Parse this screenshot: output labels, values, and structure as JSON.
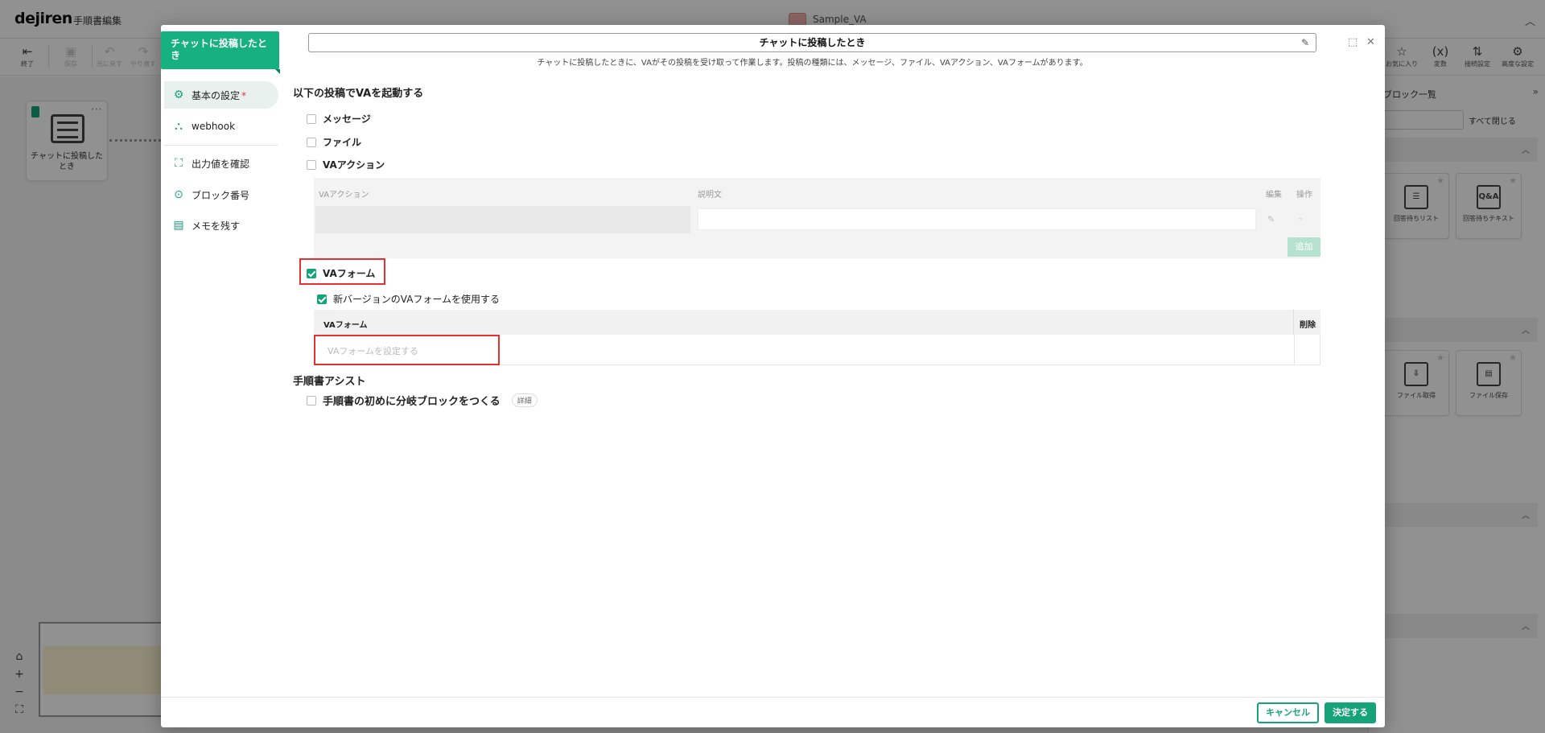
{
  "app": {
    "logo": "dejiren",
    "title": "手順書編集",
    "doc_name": "Sample_VA"
  },
  "toolbar": {
    "exit": "終了",
    "save": "保存",
    "undo": "元に戻す",
    "redo": "やり直す",
    "favorites": "お気に入り",
    "variables": "変数",
    "connection_settings": "接続設定",
    "advanced_settings": "高度な設定"
  },
  "canvas": {
    "node_label": "チャットに投稿したとき"
  },
  "right_panel": {
    "title": "ブロック一覧",
    "close_all": "すべて閉じる",
    "cards": [
      {
        "label": "回答待ちリスト",
        "icon": "list-icon"
      },
      {
        "label": "回答待ちテキスト",
        "icon": "qa-icon",
        "glyph": "Q&A"
      },
      {
        "label": "ファイル取得",
        "icon": "file-download-icon"
      },
      {
        "label": "ファイル保存",
        "icon": "file-save-icon"
      }
    ]
  },
  "modal": {
    "block_name": "チャットに投稿したとき",
    "title_value": "チャットに投稿したとき",
    "subtitle": "チャットに投稿したときに、VAがその投稿を受け取って作業します。投稿の種類には、メッセージ、ファイル、VAアクション、VAフォームがあります。",
    "side_nav": [
      {
        "label": "基本の設定",
        "required": "*",
        "icon": "gear-icon"
      },
      {
        "label": "webhook",
        "icon": "webhook-icon"
      },
      {
        "label": "出力値を確認",
        "icon": "output-icon"
      },
      {
        "label": "ブロック番号",
        "icon": "block-number-icon"
      },
      {
        "label": "メモを残す",
        "icon": "memo-icon"
      }
    ],
    "trigger_section": {
      "title": "以下の投稿でVAを起動する",
      "message": "メッセージ",
      "file": "ファイル",
      "va_action": "VAアクション",
      "va_action_table": {
        "col_action": "VAアクション",
        "col_description": "説明文",
        "col_edit": "編集",
        "col_operation": "操作",
        "add_button": "追加"
      },
      "va_form": "VAフォーム",
      "va_form_checked": true,
      "use_new_version": "新バージョンのVAフォームを使用する",
      "use_new_version_checked": true,
      "va_form_table": {
        "col_form": "VAフォーム",
        "col_delete": "削除",
        "placeholder": "VAフォームを設定する"
      }
    },
    "assist_section": {
      "title": "手順書アシスト",
      "branch_option": "手順書の初めに分岐ブロックをつくる",
      "detail": "詳細"
    },
    "buttons": {
      "cancel": "キャンセル",
      "ok": "決定する"
    }
  }
}
